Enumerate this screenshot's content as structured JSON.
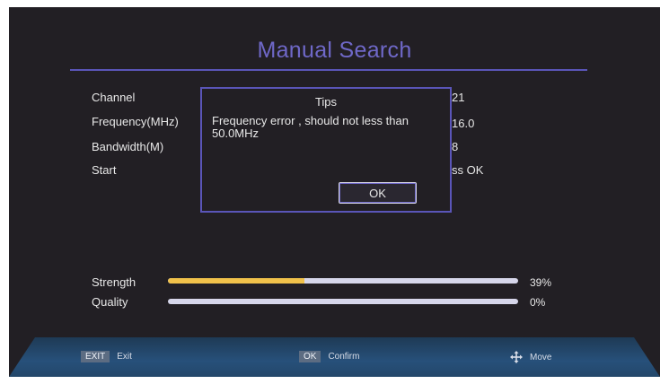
{
  "screen": {
    "title": "Manual Search"
  },
  "settings": {
    "channel_label": "Channel",
    "channel_value": "21",
    "frequency_label": "Frequency(MHz)",
    "frequency_value": "16.0",
    "bandwidth_label": "Bandwidth(M)",
    "bandwidth_value": "8",
    "start_label": "Start",
    "start_value": "ss OK"
  },
  "dialog": {
    "title": "Tips",
    "message": "Frequency error , should not less than 50.0MHz",
    "ok_label": "OK"
  },
  "signal": {
    "strength_label": "Strength",
    "strength_value": 0.39,
    "strength_text": "39%",
    "quality_label": "Quality",
    "quality_value": 0.0,
    "quality_text": "0%"
  },
  "footer": {
    "exit_key": "EXIT",
    "exit_label": "Exit",
    "ok_key": "OK",
    "ok_label": "Confirm",
    "move_label": "Move"
  },
  "colors": {
    "accent": "#6f68c8",
    "strength_bar": "#f0c14a",
    "bar_track": "#d6d6ea",
    "background": "#221f24"
  }
}
